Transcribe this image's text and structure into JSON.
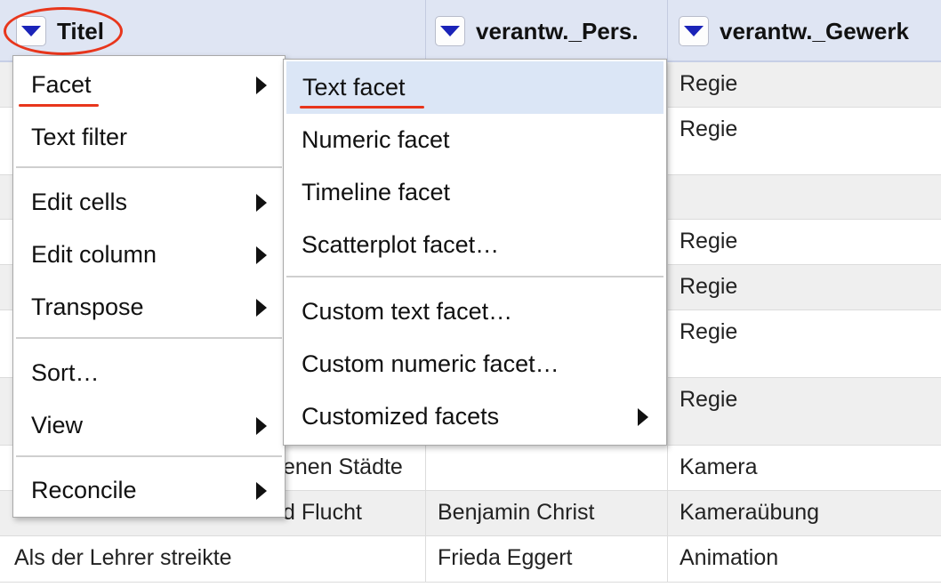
{
  "columns": [
    {
      "label": "Titel"
    },
    {
      "label": "verantw._Pers."
    },
    {
      "label": "verantw._Gewerk"
    }
  ],
  "rows": [
    {
      "c1": "",
      "c2": "",
      "c3": "Regie"
    },
    {
      "c1": "",
      "c2": "",
      "c3": "Regie"
    },
    {
      "c1": "",
      "c2": "",
      "c3": ""
    },
    {
      "c1": "",
      "c2": "",
      "c3": "Regie"
    },
    {
      "c1": "",
      "c2": "",
      "c3": "Regie"
    },
    {
      "c1": "",
      "c2": "",
      "c3": "Regie"
    },
    {
      "c1": "",
      "c2": "",
      "c3": "Regie"
    },
    {
      "c1": "enen Städte",
      "c2": "",
      "c3": "Kamera"
    },
    {
      "c1": "d Flucht",
      "c2": "Benjamin Christ",
      "c3": "Kameraübung"
    },
    {
      "c1": "Als der Lehrer streikte",
      "c2": "Frieda Eggert",
      "c3": "Animation"
    }
  ],
  "column_menu": {
    "items": [
      {
        "label": "Facet",
        "submenu": true
      },
      {
        "label": "Text filter",
        "submenu": false
      },
      {
        "label": "Edit cells",
        "submenu": true
      },
      {
        "label": "Edit column",
        "submenu": true
      },
      {
        "label": "Transpose",
        "submenu": true
      },
      {
        "label": "Sort…",
        "submenu": false
      },
      {
        "label": "View",
        "submenu": true
      },
      {
        "label": "Reconcile",
        "submenu": true
      }
    ]
  },
  "facet_submenu": {
    "items": [
      {
        "label": "Text facet",
        "submenu": false
      },
      {
        "label": "Numeric facet",
        "submenu": false
      },
      {
        "label": "Timeline facet",
        "submenu": false
      },
      {
        "label": "Scatterplot facet…",
        "submenu": false
      },
      {
        "label": "Custom text facet…",
        "submenu": false
      },
      {
        "label": "Custom numeric facet…",
        "submenu": false
      },
      {
        "label": "Customized facets",
        "submenu": true
      }
    ]
  },
  "colors": {
    "header_bg": "#dfe5f3",
    "dropdown_arrow": "#1a23b8",
    "annotation_red": "#e8361c",
    "hover_bg": "#dbe6f6"
  }
}
